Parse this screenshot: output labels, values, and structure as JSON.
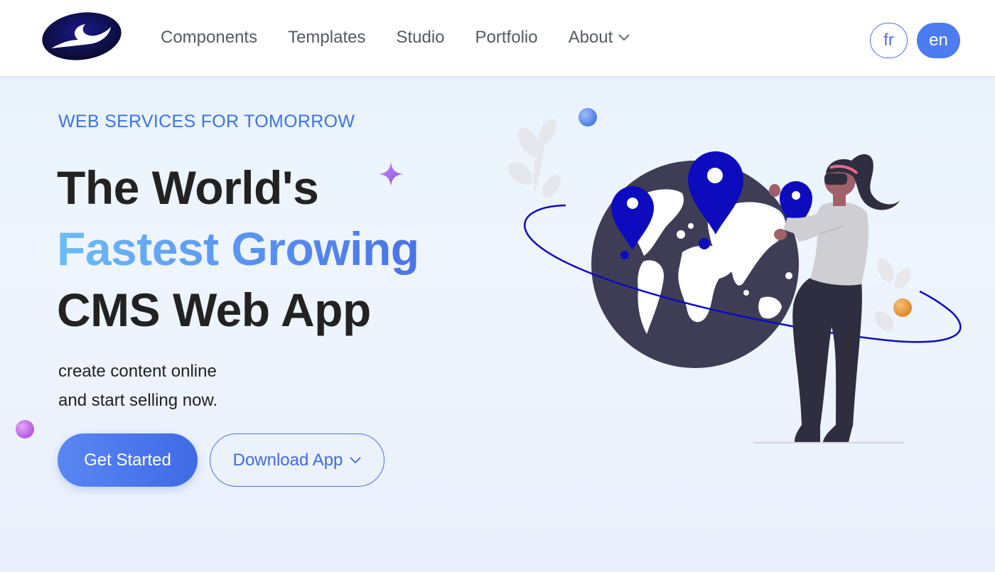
{
  "nav": {
    "items": [
      {
        "label": "Components"
      },
      {
        "label": "Templates"
      },
      {
        "label": "Studio"
      },
      {
        "label": "Portfolio"
      },
      {
        "label": "About",
        "has_dropdown": true
      }
    ],
    "languages": [
      {
        "code": "fr",
        "active": false
      },
      {
        "code": "en",
        "active": true
      }
    ]
  },
  "hero": {
    "eyebrow": "WEB SERVICES FOR TOMORROW",
    "headline_line1": "The World's",
    "headline_line2": "Fastest Growing",
    "headline_line3": "CMS Web App",
    "sub_line1": "create content online",
    "sub_line2": "and start selling now.",
    "primary_button": "Get Started",
    "secondary_button": "Download App"
  },
  "icons": {
    "logo": "wave-logo-icon",
    "dropdown": "chevron-down-icon",
    "sparkle": "sparkle-icon",
    "illustration": "world-map-woman-illustration"
  },
  "colors": {
    "accent": "#4a72e6",
    "accent_light": "#6dbcf7",
    "headline": "#222222",
    "nav_text": "#555a63",
    "pin": "#0d0bbd",
    "globe": "#3f3d56"
  }
}
